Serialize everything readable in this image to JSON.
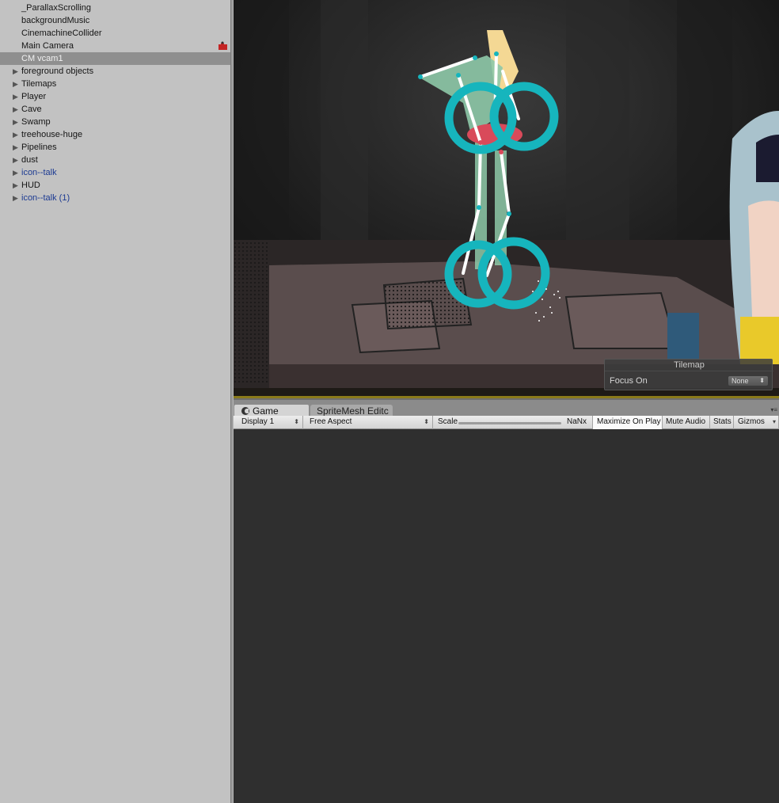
{
  "hierarchy": {
    "items": [
      {
        "label": "_ParallaxScrolling",
        "expandable": false
      },
      {
        "label": "backgroundMusic",
        "expandable": false
      },
      {
        "label": "CinemachineCollider",
        "expandable": false
      },
      {
        "label": "Main Camera",
        "expandable": false
      },
      {
        "label": "CM vcam1",
        "expandable": false,
        "selected": true
      },
      {
        "label": "foreground objects",
        "expandable": true
      },
      {
        "label": "Tilemaps",
        "expandable": true
      },
      {
        "label": "Player",
        "expandable": true
      },
      {
        "label": "Cave",
        "expandable": true
      },
      {
        "label": "Swamp",
        "expandable": true
      },
      {
        "label": "treehouse-huge",
        "expandable": true
      },
      {
        "label": "Pipelines",
        "expandable": true
      },
      {
        "label": "dust",
        "expandable": true
      },
      {
        "label": "icon--talk",
        "expandable": true,
        "prefab": true
      },
      {
        "label": "HUD",
        "expandable": true
      },
      {
        "label": "icon--talk (1)",
        "expandable": true,
        "prefab": true
      }
    ]
  },
  "tilemap_overlay": {
    "title": "Tilemap",
    "focus_label": "Focus On",
    "focus_value": "None"
  },
  "tabs": {
    "game": "Game",
    "spritemesh": "SpriteMesh Editc",
    "menu_glyph": "▾≡"
  },
  "toolbar": {
    "display": "Display 1",
    "aspect": "Free Aspect",
    "scale_label": "Scale",
    "scale_value": "NaNx",
    "maximize": "Maximize On Play",
    "mute": "Mute Audio",
    "stats": "Stats",
    "gizmos": "Gizmos"
  },
  "colors": {
    "hierarchy_bg": "#c2c2c2",
    "selected_row": "#8f8f8f",
    "prefab_text": "#1c3a92",
    "bone_collider": "#16b5bd",
    "game_view_bg": "#2f2f2f"
  },
  "icons": {
    "main_camera_gizmo": "puzzle-piece-icon",
    "game_tab": "pacman-icon",
    "expand": "triangle-right-icon"
  }
}
